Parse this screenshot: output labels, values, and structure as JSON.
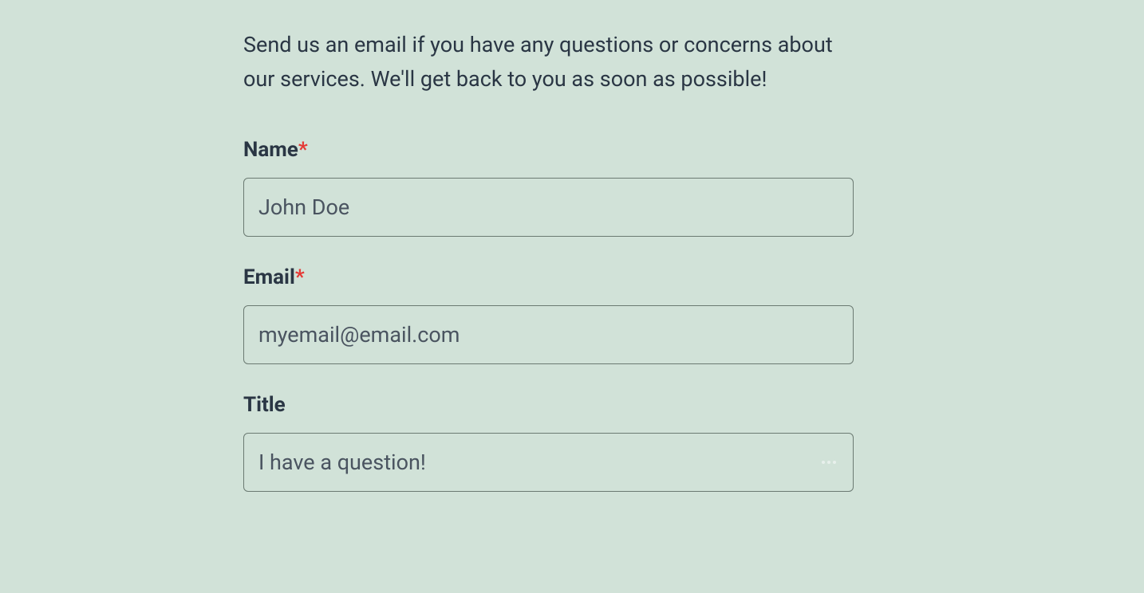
{
  "intro": "Send us an email if you have any questions or concerns about our services. We'll get back to you as soon as possible!",
  "form": {
    "name": {
      "label": "Name",
      "required_marker": "*",
      "placeholder": "John Doe",
      "value": ""
    },
    "email": {
      "label": "Email",
      "required_marker": "*",
      "placeholder": "myemail@email.com",
      "value": ""
    },
    "title": {
      "label": "Title",
      "placeholder": "I have a question!",
      "value": ""
    }
  }
}
